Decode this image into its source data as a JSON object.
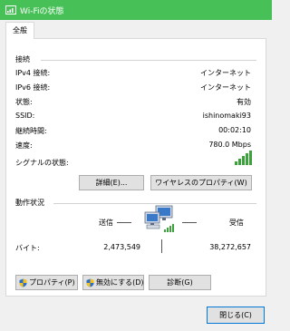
{
  "window": {
    "title": "Wi-Fiの状態"
  },
  "tabs": [
    {
      "label": "全般"
    }
  ],
  "connection": {
    "section_title": "接続",
    "rows": [
      {
        "label": "IPv4 接続:",
        "value": "インターネット"
      },
      {
        "label": "IPv6 接続:",
        "value": "インターネット"
      },
      {
        "label": "状態:",
        "value": "有効"
      },
      {
        "label": "SSID:",
        "value": "ishinomaki93"
      },
      {
        "label": "継続時間:",
        "value": "00:02:10"
      },
      {
        "label": "速度:",
        "value": "780.0 Mbps"
      }
    ],
    "signal_label": "シグナルの状態:",
    "signal_bars": 5,
    "details_button": "詳細(E)...",
    "wireless_props_button": "ワイヤレスのプロパティ(W)"
  },
  "activity": {
    "section_title": "動作状況",
    "sent_label": "送信",
    "received_label": "受信",
    "bytes_label": "バイト:",
    "bytes_sent": "2,473,549",
    "bytes_received": "38,272,657"
  },
  "actions": {
    "properties_button": "プロパティ(P)",
    "disable_button": "無効にする(D)",
    "diagnose_button": "診断(G)"
  },
  "footer": {
    "close_button": "閉じる(C)"
  },
  "colors": {
    "titlebar": "#48c058",
    "signal": "#3ca33c",
    "shield_blue": "#2b6ec6",
    "shield_yellow": "#f6c21b"
  }
}
